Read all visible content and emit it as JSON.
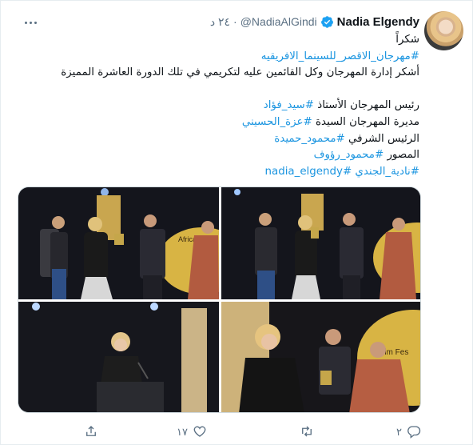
{
  "tweet": {
    "display_name": "Nadia Elgendy",
    "handle": "@NadiaAlGindi",
    "separator": "·",
    "time": "٢٤ د",
    "lines": [
      {
        "text": "شكراً",
        "link": false
      },
      {
        "text": "#مهرجان_الاقصر_للسينما_الافريقيه",
        "link": true
      },
      {
        "text": "أشكر إدارة المهرجان وكل القائمين عليه لتكريمي في تلك الدورة العاشرة المميزة",
        "link": false
      },
      {
        "text": "",
        "link": false
      },
      {
        "prefix": "رئيس المهرجان الأستاذ ",
        "tag": "#سيد_فؤاد"
      },
      {
        "prefix": "مديرة المهرجان السيدة ",
        "tag": "#عزة_الحسيني"
      },
      {
        "prefix": "الرئيس الشرفي ",
        "tag": "#محمود_حميدة"
      },
      {
        "prefix": "المصور ",
        "tag": "#محمود_رؤوف"
      },
      {
        "prefix": "",
        "tag": "#نادية_الجندي #nadia_elgendy"
      }
    ]
  },
  "media": {
    "photos": [
      {
        "name": "ceremony-group-photo-1"
      },
      {
        "name": "ceremony-group-photo-2"
      },
      {
        "name": "speech-at-podium-photo"
      },
      {
        "name": "award-handshake-photo"
      }
    ]
  },
  "actions": {
    "reply_count": "٢",
    "retweet_count": "",
    "like_count": "١٧",
    "share_count": ""
  },
  "icons": {
    "verified": "verified-badge-icon",
    "more": "more-options-icon",
    "reply": "reply-icon",
    "retweet": "retweet-icon",
    "like": "like-icon",
    "share": "share-icon"
  },
  "colors": {
    "link": "#1b95e0",
    "secondary_text": "#5b7083",
    "verified": "#1da1f2"
  }
}
